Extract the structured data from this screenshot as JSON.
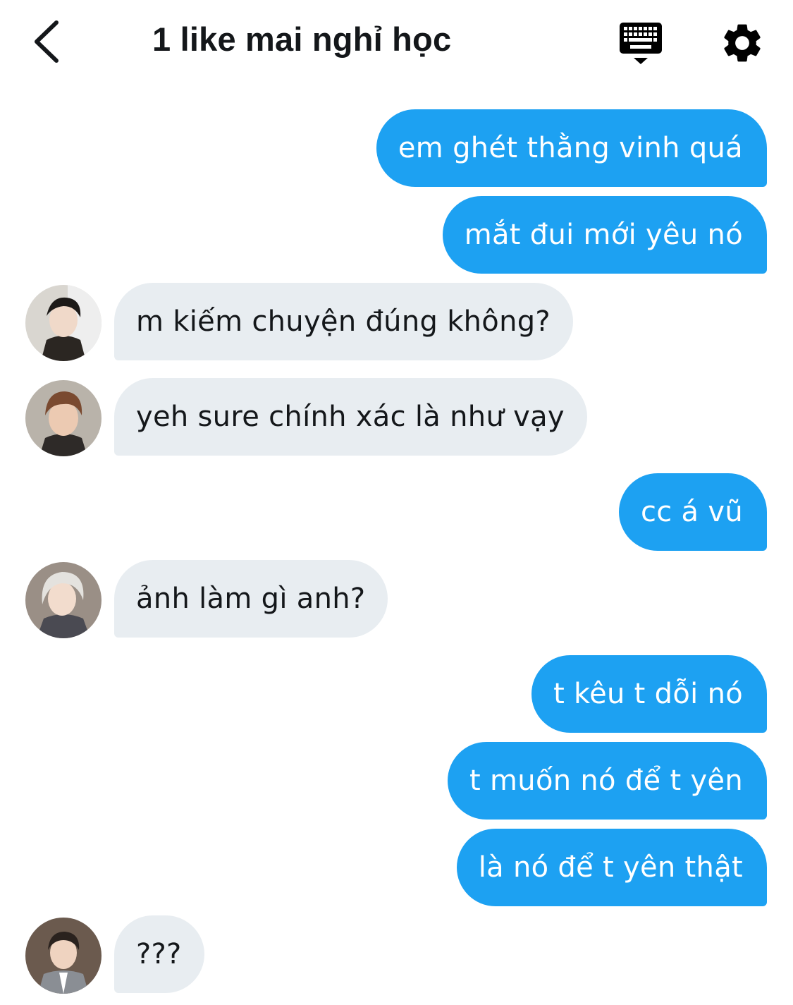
{
  "header": {
    "title": "1 like mai nghỉ học",
    "back_icon": "chevron-left-icon",
    "keyboard_icon": "keyboard-icon",
    "settings_icon": "gear-icon"
  },
  "colors": {
    "outgoing_bubble": "#1da1f2",
    "incoming_bubble": "#e8edf1",
    "text_dark": "#14171a"
  },
  "messages": [
    {
      "direction": "out",
      "text": "em ghét thằng vinh quá"
    },
    {
      "direction": "out",
      "text": "mắt đui mới yêu nó"
    },
    {
      "direction": "in",
      "text": "m kiếm chuyện đúng không?"
    },
    {
      "direction": "in",
      "text": "yeh sure chính xác là như vạy"
    },
    {
      "direction": "out",
      "text": "cc á vũ"
    },
    {
      "direction": "in",
      "text": "ảnh làm gì anh?"
    },
    {
      "direction": "out",
      "text": "t kêu t dỗi nó"
    },
    {
      "direction": "out",
      "text": "t muốn nó để t yên"
    },
    {
      "direction": "out",
      "text": "là nó để t yên thật"
    },
    {
      "direction": "in",
      "text": "???"
    }
  ]
}
